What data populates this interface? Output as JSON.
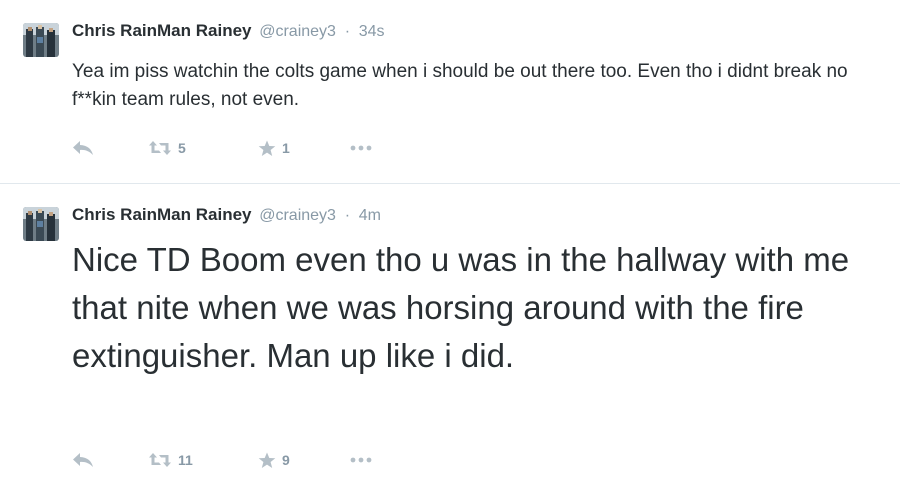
{
  "tweets": [
    {
      "fullname": "Chris RainMan Rainey",
      "username": "@crainey3",
      "separator": "·",
      "timestamp": "34s",
      "text": "Yea im piss watchin the colts game when i should be out there too. Even tho i didnt break no f**kin team rules, not even.",
      "retweets": "5",
      "favorites": "1"
    },
    {
      "fullname": "Chris RainMan Rainey",
      "username": "@crainey3",
      "separator": "·",
      "timestamp": "4m",
      "text": "Nice TD Boom even tho u was in the hallway with me that nite when we was horsing around with the fire extinguisher. Man up like i did.",
      "retweets": "11",
      "favorites": "9"
    }
  ],
  "icons": {
    "reply": "reply-icon",
    "retweet": "retweet-icon",
    "favorite": "star-icon",
    "more": "more-dots-icon"
  },
  "colors": {
    "text": "#292f33",
    "muted": "#8899a6",
    "icon": "#b4bfc7",
    "divider": "#e1e8ed"
  }
}
